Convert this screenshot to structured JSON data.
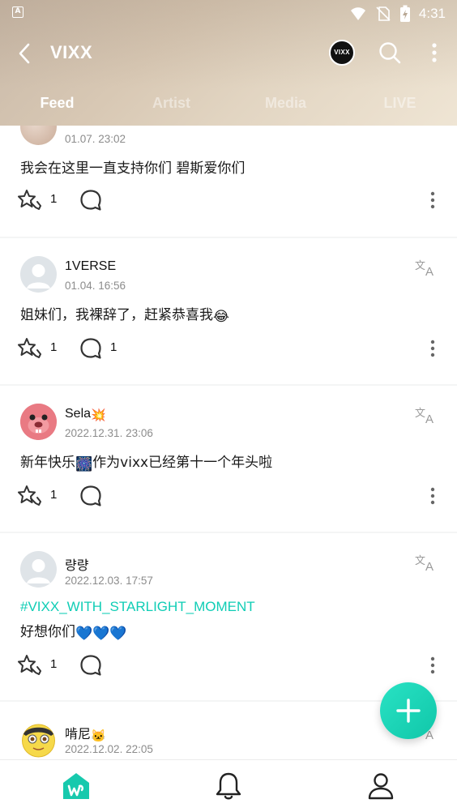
{
  "status_bar": {
    "time": "4:31",
    "indicator_letter": "A"
  },
  "header": {
    "title": "VIXX",
    "logo_text": "VIXX",
    "tabs": [
      {
        "label": "Feed",
        "active": true
      },
      {
        "label": "Artist",
        "active": false
      },
      {
        "label": "Media",
        "active": false
      },
      {
        "label": "LIVE",
        "active": false
      }
    ]
  },
  "posts": [
    {
      "name": "",
      "time": "01.07. 23:02",
      "text": "我会在这里一直支持你们 碧斯爱你们",
      "reactions": "1",
      "comments": ""
    },
    {
      "name": "1VERSE",
      "time": "01.04. 16:56",
      "text": "姐妹们，我裸辞了，赶紧恭喜我",
      "emoji": "😂",
      "reactions": "1",
      "comments": "1"
    },
    {
      "name": "Sela",
      "name_emoji": "💥",
      "time": "2022.12.31. 23:06",
      "text_before": "新年快乐",
      "emoji": "🎆",
      "text_after": "作为vixx已经第十一个年头啦",
      "reactions": "1",
      "comments": ""
    },
    {
      "name": "량량",
      "time": "2022.12.03. 17:57",
      "hashtag": "#VIXX_WITH_STARLIGHT_MOMENT",
      "text": "好想你们",
      "emoji": "💙💙💙",
      "reactions": "1",
      "comments": ""
    },
    {
      "name": "啃尼",
      "name_emoji": "🐱",
      "time": "2022.12.02. 22:05"
    }
  ],
  "colors": {
    "accent": "#10c7a9",
    "hashtag": "#0fcdb5"
  },
  "icons": [
    "back-arrow-icon",
    "search-icon",
    "more-vertical-icon",
    "translate-icon",
    "reaction-icon",
    "comment-icon",
    "plus-icon",
    "home-icon",
    "bell-icon",
    "profile-icon"
  ]
}
